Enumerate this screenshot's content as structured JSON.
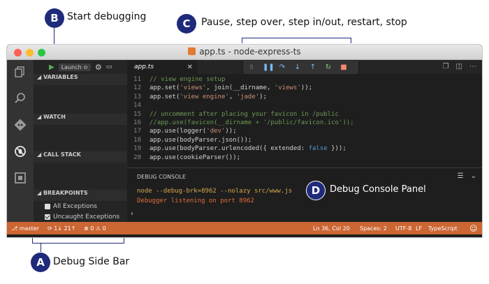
{
  "callouts": {
    "a": {
      "letter": "A",
      "text": "Debug Side Bar"
    },
    "b": {
      "letter": "B",
      "text": "Start debugging"
    },
    "c": {
      "letter": "C",
      "text": "Pause, step over, step in/out, restart, stop"
    },
    "d": {
      "letter": "D",
      "text": "Debug Console Panel"
    }
  },
  "window": {
    "title": "app.ts - node-express-ts"
  },
  "sidebar": {
    "launch_label": "Launch ≎",
    "sections": {
      "variables": "VARIABLES",
      "watch": "WATCH",
      "callstack": "CALL STACK",
      "breakpoints": "BREAKPOINTS"
    },
    "breakpoints": [
      {
        "label": "All Exceptions",
        "checked": false
      },
      {
        "label": "Uncaught Exceptions",
        "checked": true
      }
    ]
  },
  "tab": {
    "label": "app.ts",
    "close": "✕"
  },
  "editor": {
    "lines": [
      {
        "n": "11",
        "t": "// view engine setup"
      },
      {
        "n": "12",
        "t": "app.set('views', join(__dirname, 'views'));"
      },
      {
        "n": "13",
        "t": "app.set('view engine', 'jade');"
      },
      {
        "n": "14",
        "t": ""
      },
      {
        "n": "15",
        "t": "// uncomment after placing your favicon in /public"
      },
      {
        "n": "16",
        "t": "//app.use(favicon(__dirname + '/public/favicon.ico'));"
      },
      {
        "n": "17",
        "t": "app.use(logger('dev'));"
      },
      {
        "n": "18",
        "t": "app.use(bodyParser.json());"
      },
      {
        "n": "19",
        "t": "app.use(bodyParser.urlencoded({ extended: false }));"
      },
      {
        "n": "20",
        "t": "app.use(cookieParser());"
      }
    ]
  },
  "console": {
    "title": "DEBUG CONSOLE",
    "lines": [
      "node --debug-brk=8962 --nolazy src/www.js",
      "Debugger listening on port 8962"
    ],
    "prompt": "›"
  },
  "statusbar": {
    "branch": "master",
    "sync": "1↓ 21↑",
    "errors": "0",
    "warnings": "0",
    "position": "Ln 36, Col 20",
    "spaces": "Spaces: 2",
    "encoding": "UTF-8",
    "eol": "LF",
    "language": "TypeScript",
    "smiley": "☺"
  },
  "colors": {
    "badge": "#1f2a7a",
    "statusbar": "#cc6633",
    "console_text": "#e06c3c",
    "console_cmd": "#d7a84a"
  }
}
